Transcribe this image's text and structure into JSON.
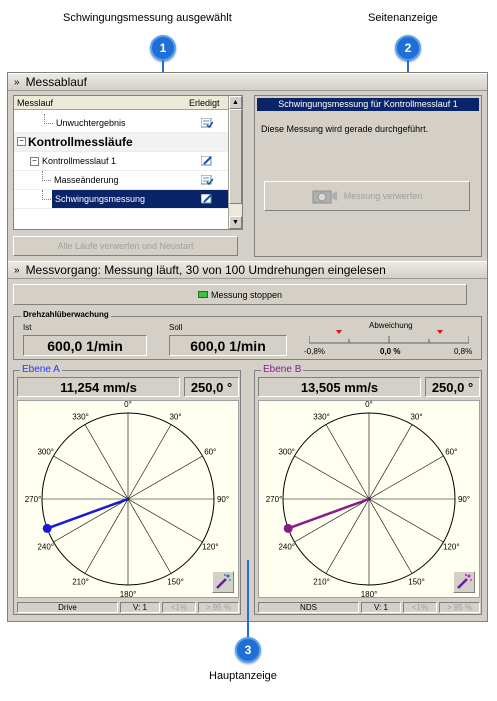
{
  "captions": {
    "c1": "Schwingungsmessung ausgewählt",
    "c2": "Seitenanzeige",
    "c3": "Hauptanzeige",
    "n1": "1",
    "n2": "2",
    "n3": "3"
  },
  "messablauf": {
    "title": "Messablauf",
    "col_lauf": "Messlauf",
    "col_done": "Erledigt",
    "rows": {
      "r0": "Unwuchtergebnis",
      "r1": "Kontrollmessläufe",
      "r2": "Kontrollmesslauf 1",
      "r3": "Masseänderung",
      "r4": "Schwingungsmessung"
    },
    "reset_button": "Alle Läufe verwerfen und Neustart"
  },
  "side": {
    "title": "Schwingungsmessung für Kontrollmesslauf 1",
    "text": "Diese Messung wird gerade durchgeführt.",
    "discard_button": "Messung verwerfen"
  },
  "messvorgang": {
    "title": "Messvorgang: Messung läuft, 30 von 100 Umdrehungen eingelesen",
    "stop_button": "Messung stoppen"
  },
  "drehzahl": {
    "title": "Drehzahlüberwachung",
    "ist_label": "Ist",
    "ist_value": "600,0 1/min",
    "soll_label": "Soll",
    "soll_value": "600,0 1/min",
    "abw_label": "Abweichung",
    "abw_min": "-0,8%",
    "abw_val": "0,0 %",
    "abw_max": "0,8%"
  },
  "planes": {
    "a": {
      "title": "Ebene A",
      "amp": "11,254 mm/s",
      "angle": "250,0 °",
      "angle_deg": 250,
      "color": "#1a1ad4",
      "s1": "Drive",
      "s2": "V: 1",
      "s3": "<1%",
      "s4": "> 95 %"
    },
    "b": {
      "title": "Ebene B",
      "amp": "13,505 mm/s",
      "angle": "250,0 °",
      "angle_deg": 250,
      "color": "#8b1a8b",
      "s1": "NDS",
      "s2": "V: 1",
      "s3": "<1%",
      "s4": "> 95 %"
    }
  },
  "dial_labels": [
    "0°",
    "30°",
    "60°",
    "90°",
    "120°",
    "150°",
    "180°",
    "210°",
    "240°",
    "270°",
    "300°",
    "330°"
  ]
}
